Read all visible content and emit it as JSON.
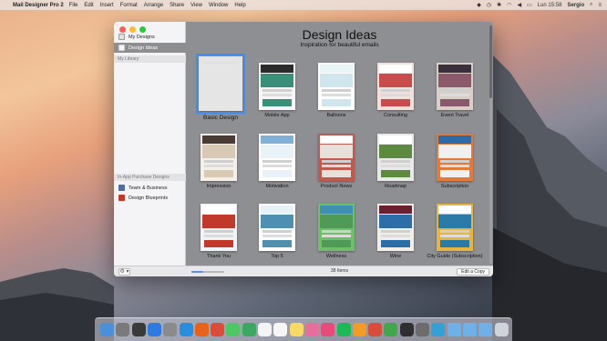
{
  "menubar": {
    "app_name": "Mail Designer Pro 2",
    "menus": [
      "File",
      "Edit",
      "Insert",
      "Format",
      "Arrange",
      "Share",
      "View",
      "Window",
      "Help"
    ],
    "clock": "Lun 15:58",
    "user": "Sergio"
  },
  "sidebar": {
    "items": [
      {
        "label": "My Designs",
        "icon": "folder-icon",
        "color": "#e0e0e0"
      },
      {
        "label": "Design Ideas",
        "icon": "lightbulb-icon",
        "color": "#f5f5f5",
        "selected": true
      }
    ],
    "library_header": "My Library",
    "purchase_header": "In-App Purchase Designs",
    "purchase_items": [
      {
        "label": "Team & Business",
        "icon": "team-icon",
        "color": "#4a6fa5"
      },
      {
        "label": "Design Blueprints",
        "icon": "blueprint-icon",
        "color": "#c0392b"
      }
    ]
  },
  "main": {
    "title": "Design Ideas",
    "subtitle": "Inspiration for beautiful emails"
  },
  "templates": [
    {
      "label": "Basic Design",
      "selected": true,
      "colors": [
        "#ffffff",
        "#ffffff",
        "#e5e5e5"
      ]
    },
    {
      "label": "Mobile App",
      "colors": [
        "#2b2b2b",
        "#3a8f7a",
        "#f5f5f5"
      ]
    },
    {
      "label": "Balloons",
      "colors": [
        "#e9f4f8",
        "#cfe6ef",
        "#ffffff"
      ]
    },
    {
      "label": "Consulting",
      "colors": [
        "#ffffff",
        "#c94b4b",
        "#f1e1dc"
      ]
    },
    {
      "label": "Event Travel",
      "colors": [
        "#3a2f3c",
        "#8a5a6b",
        "#d8cfc8"
      ]
    },
    {
      "label": "Impression",
      "colors": [
        "#4a3c34",
        "#d8c9b4",
        "#f4efe8"
      ]
    },
    {
      "label": "Motivation",
      "colors": [
        "#7fb0d6",
        "#e8f2f8",
        "#ffffff"
      ]
    },
    {
      "label": "Product News",
      "colors": [
        "#ffffff",
        "#e8e0da",
        "#c05a4e"
      ]
    },
    {
      "label": "Roadmap",
      "colors": [
        "#ffffff",
        "#5c8a3e",
        "#e9e9e9"
      ]
    },
    {
      "label": "Subscription",
      "colors": [
        "#2d6aa8",
        "#f0f0f0",
        "#e27b3a"
      ]
    },
    {
      "label": "Thank You",
      "colors": [
        "#ffffff",
        "#c0392b",
        "#eef4f8"
      ]
    },
    {
      "label": "Top 5",
      "colors": [
        "#e8f1f5",
        "#4f8fb0",
        "#ffffff"
      ]
    },
    {
      "label": "Wellness",
      "colors": [
        "#3e8fb2",
        "#4f9a57",
        "#6ebf6a"
      ]
    },
    {
      "label": "Wine",
      "colors": [
        "#6b2030",
        "#2c6fa8",
        "#f3eee8"
      ]
    },
    {
      "label": "City Guide (Subscription)",
      "colors": [
        "#ffffff",
        "#2a7aa8",
        "#e8b440"
      ]
    }
  ],
  "footer": {
    "item_count": "38 Items",
    "edit_button": "Edit a Copy",
    "zoom_level": 0.35,
    "gear_label": "⚙ ▾"
  },
  "dock": [
    {
      "icon": "finder-icon",
      "color": "#4a90d9"
    },
    {
      "icon": "launchpad-icon",
      "color": "#7a7a7a"
    },
    {
      "icon": "mission-control-icon",
      "color": "#3a3a3a"
    },
    {
      "icon": "app-store-icon",
      "color": "#2d7be0"
    },
    {
      "icon": "system-preferences-icon",
      "color": "#8a8a8a"
    },
    {
      "icon": "safari-icon",
      "color": "#2a8ee0"
    },
    {
      "icon": "firefox-icon",
      "color": "#e8621a"
    },
    {
      "icon": "chrome-icon",
      "color": "#dd4b39"
    },
    {
      "icon": "messages-icon",
      "color": "#4cc764"
    },
    {
      "icon": "facetime-icon",
      "color": "#3aa860"
    },
    {
      "icon": "calendar-icon",
      "color": "#f4f4f4"
    },
    {
      "icon": "reminders-icon",
      "color": "#f6f6f6"
    },
    {
      "icon": "notes-icon",
      "color": "#f7d966"
    },
    {
      "icon": "photos-icon",
      "color": "#e86d9a"
    },
    {
      "icon": "itunes-icon",
      "color": "#e84a7a"
    },
    {
      "icon": "spotify-icon",
      "color": "#1db954"
    },
    {
      "icon": "ibooks-icon",
      "color": "#f29b25"
    },
    {
      "icon": "mail-designer-icon",
      "color": "#d84c3a"
    },
    {
      "icon": "evernote-icon",
      "color": "#3fa84a"
    },
    {
      "icon": "activity-monitor-icon",
      "color": "#2f2f2f"
    },
    {
      "icon": "disk-utility-icon",
      "color": "#6c6c6c"
    },
    {
      "icon": "telegram-icon",
      "color": "#34a0d8"
    },
    {
      "icon": "applications-folder-icon",
      "color": "#6fb0e8"
    },
    {
      "icon": "documents-folder-icon",
      "color": "#6fb0e8"
    },
    {
      "icon": "downloads-folder-icon",
      "color": "#6fb0e8"
    },
    {
      "icon": "trash-icon",
      "color": "#cfd4da"
    }
  ]
}
